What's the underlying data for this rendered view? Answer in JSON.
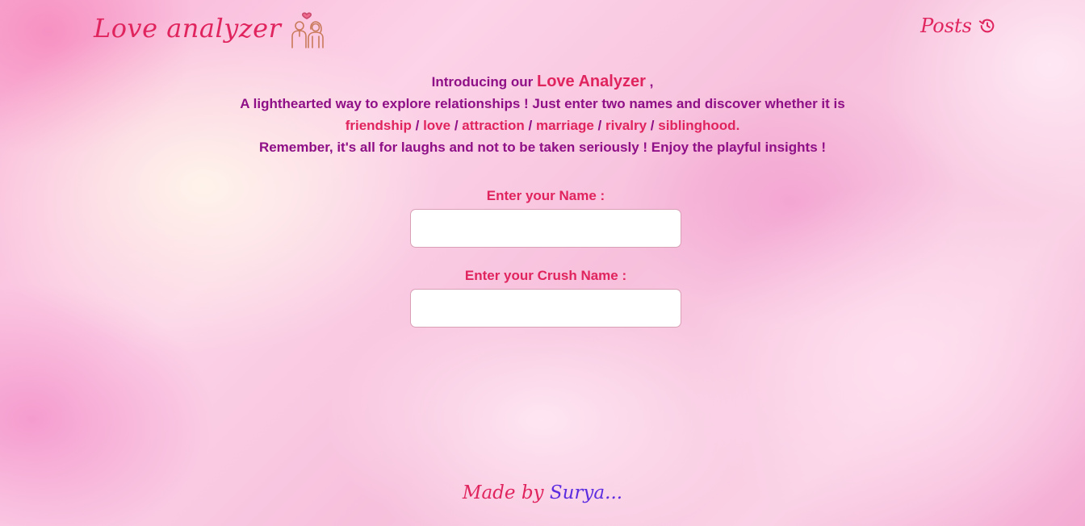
{
  "header": {
    "logo_text": "Love analyzer",
    "logo_icon": "couple-icon",
    "posts_label": "Posts",
    "posts_icon": "history-icon"
  },
  "intro": {
    "line1_prefix": "Introducing our",
    "line1_brand": "Love Analyzer",
    "line1_suffix": ",",
    "line2": "A lighthearted way to explore relationships ! Just enter two names and discover whether it is",
    "categories": [
      "friendship",
      "love",
      "attraction",
      "marriage",
      "rivalry",
      "siblinghood"
    ],
    "category_separator": "/",
    "line3_end": ".",
    "line4": "Remember, it's all for laughs and not to be taken seriously ! Enjoy the playful insights !"
  },
  "form": {
    "name_label": "Enter your Name :",
    "name_value": "",
    "crush_label": "Enter your Crush Name :",
    "crush_value": ""
  },
  "footer": {
    "made_by": "Made by",
    "author": "Surya..."
  },
  "colors": {
    "accent": "#e0245e",
    "text_purple": "#8e0f86",
    "author_blue": "#5b2be0"
  }
}
